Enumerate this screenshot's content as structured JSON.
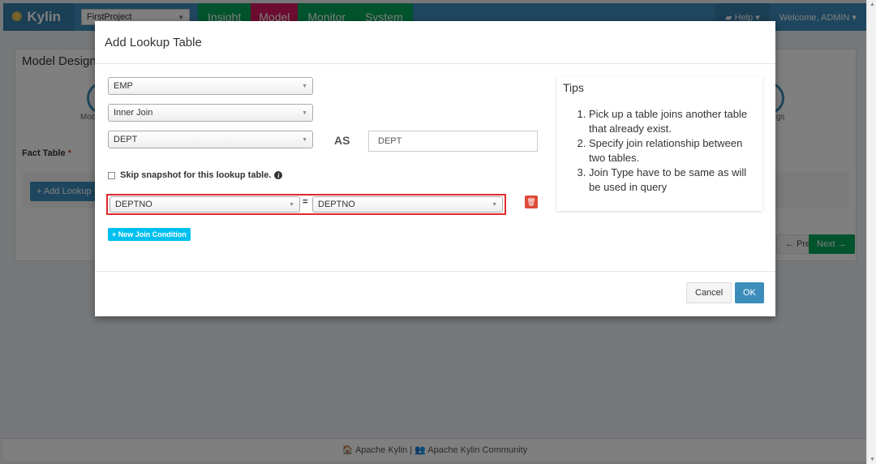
{
  "navbar": {
    "brand": "Kylin",
    "project": "FirstProject",
    "tabs": [
      {
        "label": "Insight"
      },
      {
        "label": "Model"
      },
      {
        "label": "Monitor"
      },
      {
        "label": "System"
      }
    ],
    "help": "Help ▾",
    "welcome": "Welcome, ADMIN ▾"
  },
  "background": {
    "page_title": "Model Design",
    "step_left": "Mod",
    "step_right": "gs",
    "fact_table_label": "Fact Table",
    "required_mark": "*",
    "add_lookup": "+ Add Lookup",
    "prev": "← Prev",
    "next": "Next →",
    "footer": "🏠 Apache Kylin | 👥 Apache Kylin Community"
  },
  "modal": {
    "title": "Add Lookup Table",
    "table_select": "EMP",
    "join_type_select": "Inner Join",
    "lookup_table_select": "DEPT",
    "as_label": "AS",
    "alias_value": "DEPT",
    "skip_snapshot_label": "Skip snapshot for this lookup table.",
    "join_condition": {
      "left_column": "DEPTNO",
      "operator": "=",
      "right_column": "DEPTNO"
    },
    "new_join_condition": "+ New Join Condition",
    "tips": {
      "title": "Tips",
      "items": [
        "Pick up a table joins another table that already exist.",
        "Specify join relationship between two tables.",
        "Join Type have to be same as will be used in query"
      ]
    },
    "cancel": "Cancel",
    "ok": "OK"
  }
}
